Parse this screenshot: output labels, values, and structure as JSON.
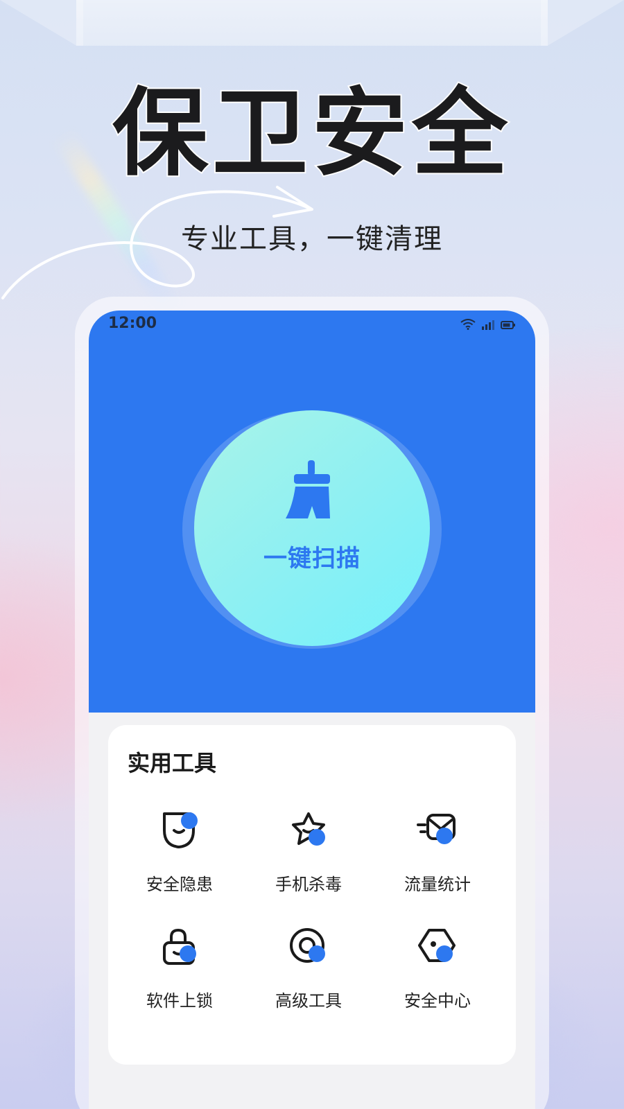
{
  "hero": {
    "title": "保卫安全",
    "subtitle": "专业工具，一键清理"
  },
  "status_bar": {
    "time": "12:00",
    "icons": [
      "wifi-icon",
      "signal-icon",
      "battery-icon"
    ]
  },
  "scan": {
    "label": "一键扫描",
    "icon": "broom-icon"
  },
  "tools": {
    "title": "实用工具",
    "items": [
      {
        "label": "安全隐患",
        "icon": "shield-icon"
      },
      {
        "label": "手机杀毒",
        "icon": "star-icon"
      },
      {
        "label": "流量统计",
        "icon": "mail-icon"
      },
      {
        "label": "软件上锁",
        "icon": "lock-icon"
      },
      {
        "label": "高级工具",
        "icon": "disc-icon"
      },
      {
        "label": "安全中心",
        "icon": "hexagon-icon"
      }
    ]
  },
  "colors": {
    "primary_blue": "#2d78f0",
    "scan_gradient_start": "#a9f4e8",
    "scan_gradient_end": "#74f1fb",
    "title_text": "#1b1b1d"
  }
}
